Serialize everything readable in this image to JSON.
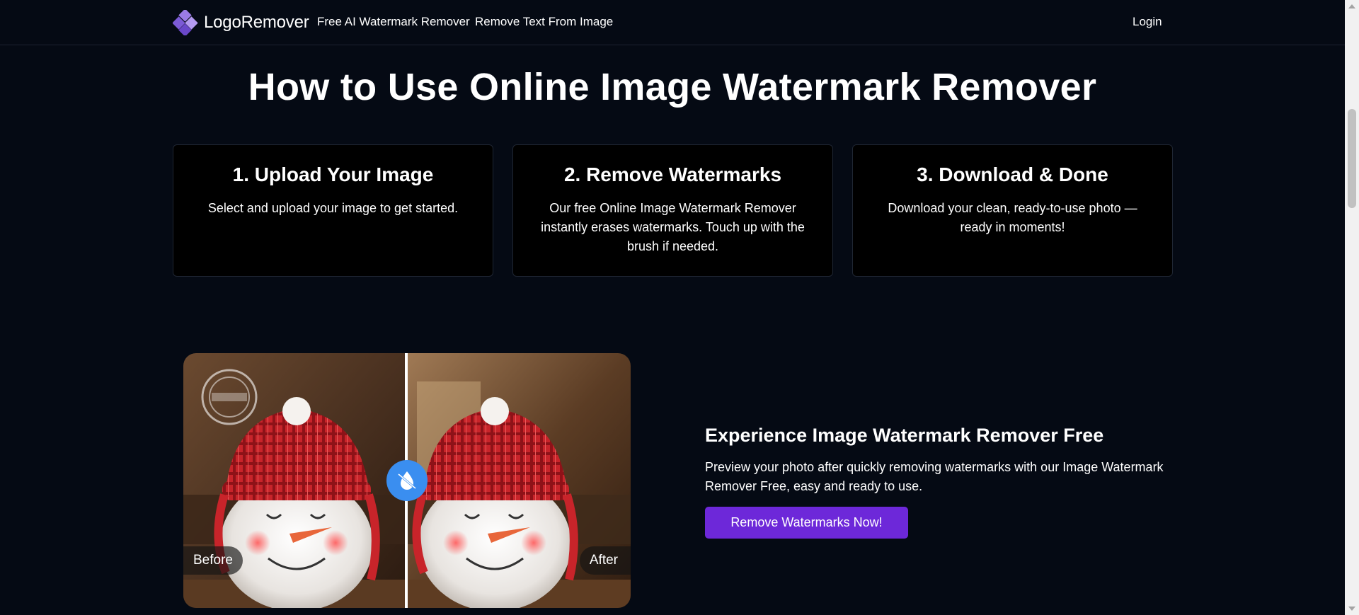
{
  "nav": {
    "brand": "LogoRemover",
    "links": [
      "Free AI Watermark Remover",
      "Remove Text From Image"
    ],
    "login": "Login"
  },
  "how_to": {
    "title": "How to Use Online Image Watermark Remover",
    "steps": [
      {
        "title": "1. Upload Your Image",
        "desc": "Select and upload your image to get started."
      },
      {
        "title": "2. Remove Watermarks",
        "desc": "Our free Online Image Watermark Remover instantly erases watermarks. Touch up with the brush if needed."
      },
      {
        "title": "3. Download & Done",
        "desc": "Download your clean, ready-to-use photo — ready in moments!"
      }
    ]
  },
  "compare": {
    "before_label": "Before",
    "after_label": "After"
  },
  "promo": {
    "title": "Experience Image Watermark Remover Free",
    "desc": "Preview your photo after quickly removing watermarks with our Image Watermark Remover Free, easy and ready to use.",
    "button": "Remove Watermarks Now!"
  },
  "colors": {
    "background": "#050a14",
    "accent_button": "#6d28d9",
    "handle": "#3a8ef0"
  }
}
